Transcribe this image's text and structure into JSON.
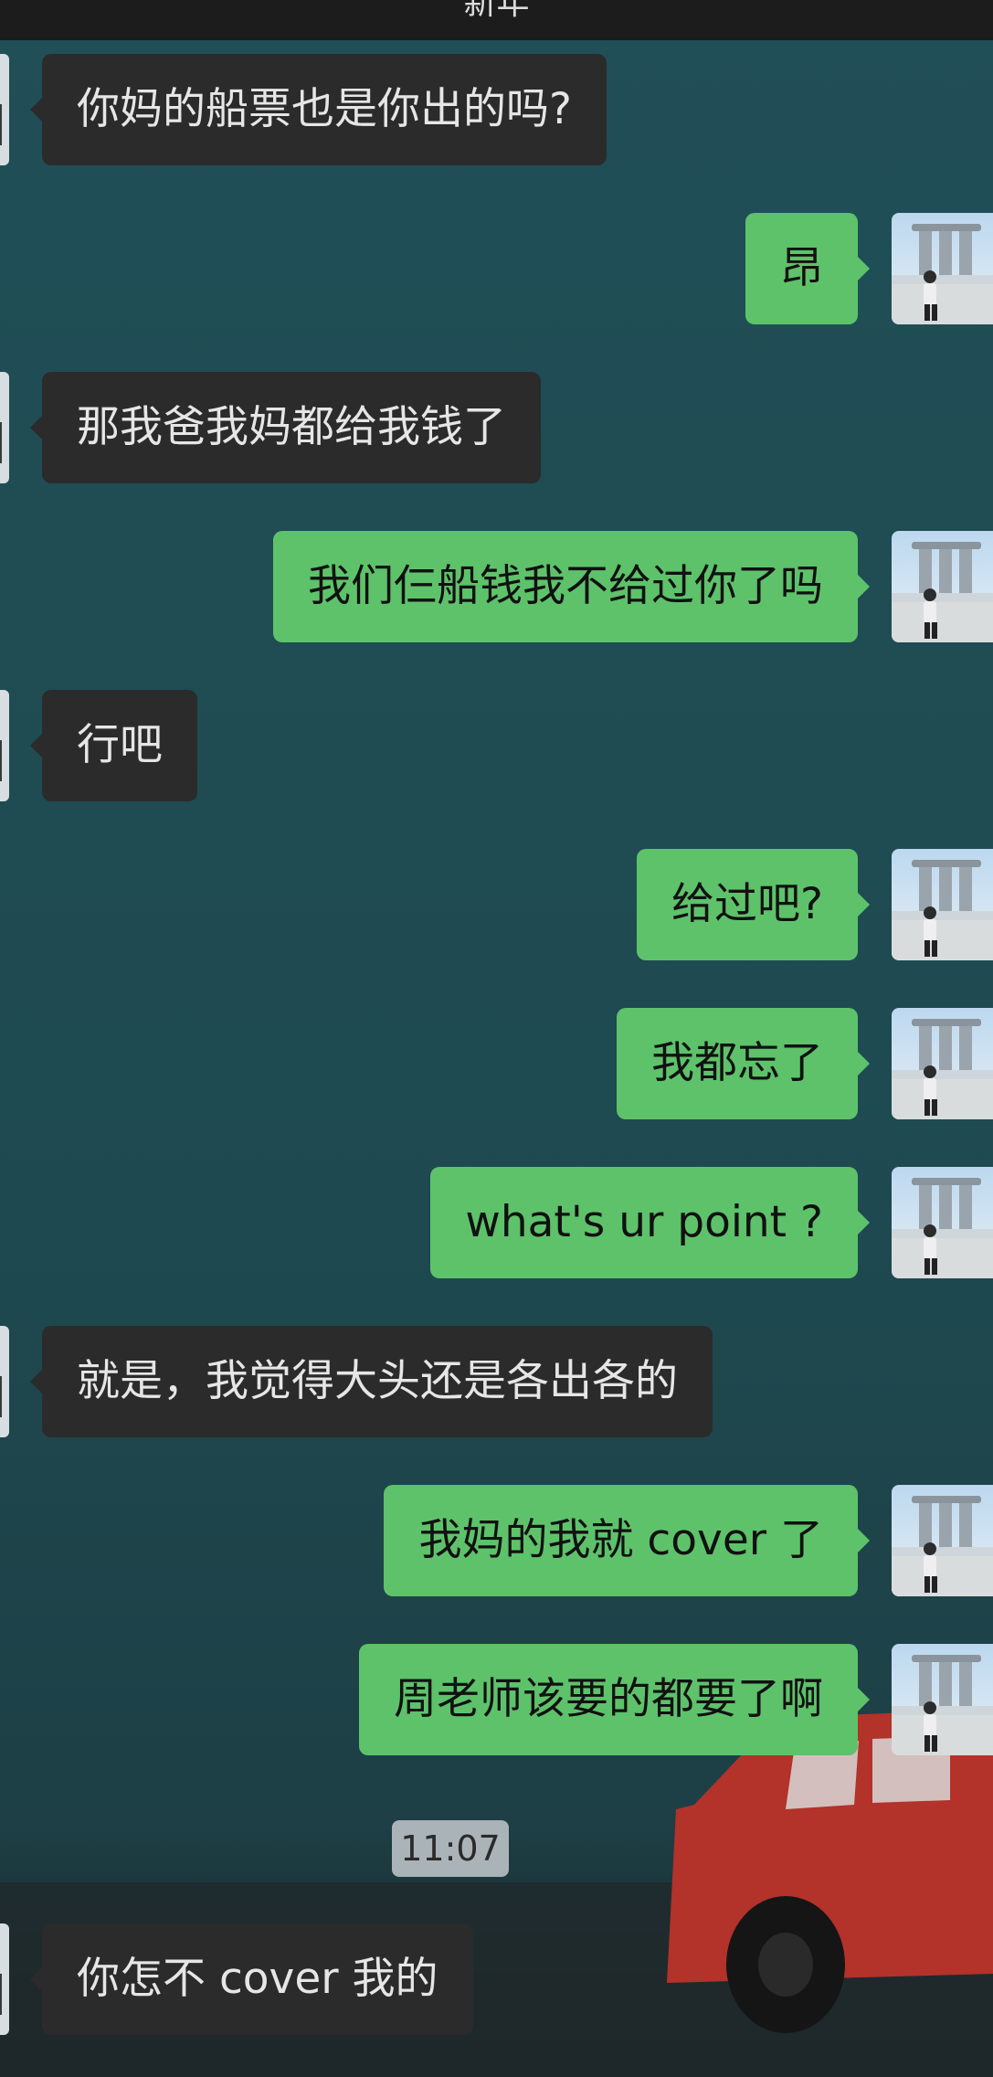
{
  "header": {
    "title_fragment": "新年"
  },
  "timestamp": "11:07",
  "messages": [
    {
      "side": "in",
      "text": "你妈的船票也是你出的吗?"
    },
    {
      "side": "out",
      "text": "昂"
    },
    {
      "side": "in",
      "text": "那我爸我妈都给我钱了"
    },
    {
      "side": "out",
      "text": "我们仨船钱我不给过你了吗"
    },
    {
      "side": "in",
      "text": "行吧"
    },
    {
      "side": "out",
      "text": "给过吧?"
    },
    {
      "side": "out",
      "text": "我都忘了"
    },
    {
      "side": "out",
      "text": "what's ur point ?"
    },
    {
      "side": "in",
      "text": "就是，我觉得大头还是各出各的"
    },
    {
      "side": "out",
      "text": "我妈的我就 cover 了"
    },
    {
      "side": "out",
      "text": "周老师该要的都要了啊"
    },
    {
      "side": "in",
      "text": "你怎不 cover 我的"
    }
  ],
  "colors": {
    "wallpaper": "#1f4a52",
    "incoming_bubble": "#2b2b2b",
    "outgoing_bubble": "#5ec26b",
    "timestamp_bg": "#aab3b7"
  }
}
